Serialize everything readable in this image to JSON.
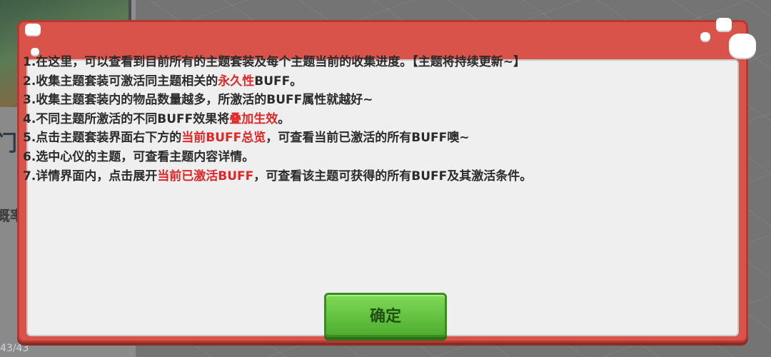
{
  "background": {
    "left_text_1": "门星",
    "left_text_2": "概率",
    "page_indicator": "43/43"
  },
  "dialog": {
    "rules": [
      {
        "number": "1.",
        "parts": [
          {
            "text": "在这里，可以查看到目前所有的主题套装及每个主题当前的收集进度。【主题将持续更新~】",
            "highlight": false
          }
        ]
      },
      {
        "number": "2.",
        "parts": [
          {
            "text": "收集主题套装可激活同主题相关的",
            "highlight": false
          },
          {
            "text": "永久性",
            "highlight": true
          },
          {
            "text": "BUFF。",
            "highlight": false
          }
        ]
      },
      {
        "number": "3.",
        "parts": [
          {
            "text": "收集主题套装内的物品数量越多，所激活的BUFF属性就越好~",
            "highlight": false
          }
        ]
      },
      {
        "number": "4.",
        "parts": [
          {
            "text": "不同主题所激活的不同BUFF效果将",
            "highlight": false
          },
          {
            "text": "叠加生效",
            "highlight": true
          },
          {
            "text": "。",
            "highlight": false
          }
        ]
      },
      {
        "number": "5.",
        "parts": [
          {
            "text": "点击主题套装界面右下方的",
            "highlight": false
          },
          {
            "text": "当前BUFF总览",
            "highlight": true
          },
          {
            "text": "，可查看当前已激活的所有BUFF噢~",
            "highlight": false
          }
        ]
      },
      {
        "number": "6.",
        "parts": [
          {
            "text": "选中心仪的主题，可查看主题内容详情。",
            "highlight": false
          }
        ]
      },
      {
        "number": "7.",
        "parts": [
          {
            "text": "详情界面内，点击展开",
            "highlight": false
          },
          {
            "text": "当前已激活BUFF",
            "highlight": true
          },
          {
            "text": "，可查看该主题可获得的所有BUFF及其激活条件。",
            "highlight": false
          }
        ]
      }
    ],
    "confirm_label": "确定"
  },
  "colors": {
    "dialog_frame": "#d9534a",
    "dialog_body": "#efefef",
    "highlight_text": "#e02626",
    "confirm_button": "#5fc23a"
  }
}
